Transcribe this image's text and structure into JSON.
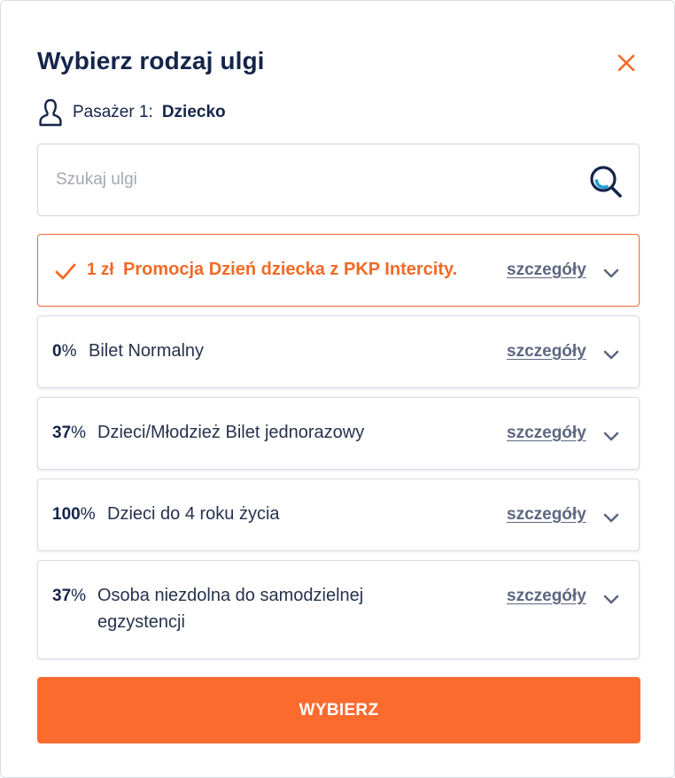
{
  "dialog": {
    "title": "Wybierz rodzaj ulgi",
    "close_icon": "close-icon",
    "accent_color": "#fb6b2e",
    "text_color": "#14254a"
  },
  "passenger": {
    "icon": "person-icon",
    "label": "Pasażer 1:",
    "value": "Dziecko"
  },
  "search": {
    "placeholder": "Szukaj ulgi",
    "value": "",
    "icon": "search-icon"
  },
  "discounts": [
    {
      "percent": "1 zł",
      "unit": "",
      "name": "Promocja Dzień dziecka z PKP Intercity.",
      "details_label": "szczegóły",
      "selected": true
    },
    {
      "percent": "0",
      "unit": "%",
      "name": "Bilet Normalny",
      "details_label": "szczegóły",
      "selected": false
    },
    {
      "percent": "37",
      "unit": "%",
      "name": "Dzieci/Młodzież Bilet jednorazowy",
      "details_label": "szczegóły",
      "selected": false
    },
    {
      "percent": "100",
      "unit": "%",
      "name": "Dzieci do 4 roku życia",
      "details_label": "szczegóły",
      "selected": false
    },
    {
      "percent": "37",
      "unit": "%",
      "name": "Osoba niezdolna do samodzielnej egzystencji",
      "details_label": "szczegóły",
      "selected": false
    }
  ],
  "actions": {
    "choose_label": "WYBIERZ"
  }
}
